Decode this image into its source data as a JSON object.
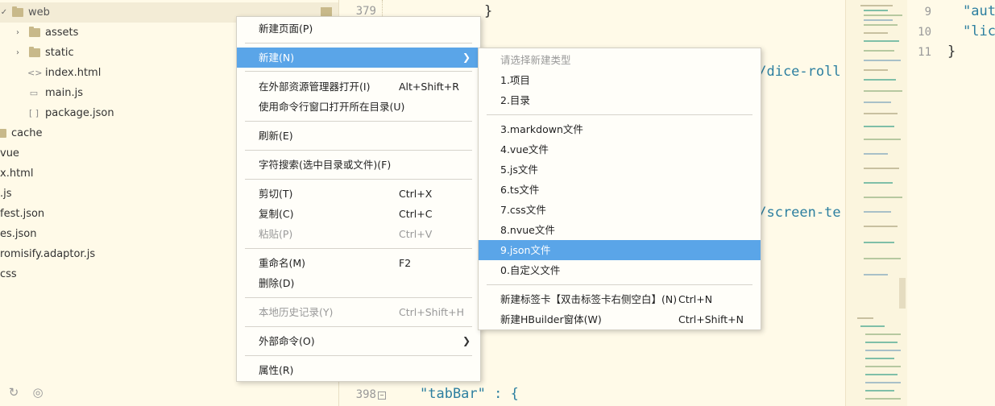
{
  "sidebar": {
    "items": [
      {
        "label": "web",
        "icon": "folder-icon"
      },
      {
        "label": "assets",
        "icon": "folder-icon"
      },
      {
        "label": "static",
        "icon": "folder-icon"
      },
      {
        "label": "index.html",
        "icon": "html-file-icon"
      },
      {
        "label": "main.js",
        "icon": "js-file-icon"
      },
      {
        "label": "package.json",
        "icon": "json-file-icon"
      },
      {
        "label": "cache",
        "icon": "folder-icon"
      },
      {
        "label": "vue",
        "icon": "file-icon"
      },
      {
        "label": "x.html",
        "icon": "file-icon"
      },
      {
        "label": ".js",
        "icon": "file-icon"
      },
      {
        "label": "fest.json",
        "icon": "file-icon"
      },
      {
        "label": "es.json",
        "icon": "file-icon"
      },
      {
        "label": "romisify.adaptor.js",
        "icon": "file-icon"
      },
      {
        "label": "css",
        "icon": "file-icon"
      }
    ],
    "footer_icons": [
      "refresh-icon",
      "globe-icon"
    ]
  },
  "editor": {
    "lines": [
      {
        "num": "379",
        "text": "}"
      },
      {
        "num": "398",
        "text": "\"tabBar\" : {"
      }
    ],
    "fragments": [
      "c/dice-roll",
      "c/screen-te"
    ]
  },
  "right_editor": {
    "lines": [
      {
        "num": "9",
        "text": "\"aut"
      },
      {
        "num": "10",
        "text": "\"lic"
      },
      {
        "num": "11",
        "text": "}"
      }
    ]
  },
  "context_menu": {
    "items": [
      {
        "label": "新建页面(P)",
        "shortcut": ""
      },
      {
        "label": "新建(N)",
        "shortcut": "",
        "submenu": true
      },
      {
        "label": "在外部资源管理器打开(I)",
        "shortcut": "Alt+Shift+R"
      },
      {
        "label": "使用命令行窗口打开所在目录(U)",
        "shortcut": ""
      },
      {
        "label": "刷新(E)",
        "shortcut": ""
      },
      {
        "label": "字符搜索(选中目录或文件)(F)",
        "shortcut": ""
      },
      {
        "label": "剪切(T)",
        "shortcut": "Ctrl+X"
      },
      {
        "label": "复制(C)",
        "shortcut": "Ctrl+C"
      },
      {
        "label": "粘贴(P)",
        "shortcut": "Ctrl+V",
        "disabled": true
      },
      {
        "label": "重命名(M)",
        "shortcut": "F2"
      },
      {
        "label": "删除(D)",
        "shortcut": ""
      },
      {
        "label": "本地历史记录(Y)",
        "shortcut": "Ctrl+Shift+H",
        "disabled": true
      },
      {
        "label": "外部命令(O)",
        "shortcut": "",
        "submenu": true
      },
      {
        "label": "属性(R)",
        "shortcut": ""
      }
    ]
  },
  "submenu": {
    "header": "请选择新建类型",
    "items": [
      {
        "label": "1.项目",
        "shortcut": ""
      },
      {
        "label": "2.目录",
        "shortcut": ""
      },
      {
        "label": "3.markdown文件",
        "shortcut": ""
      },
      {
        "label": "4.vue文件",
        "shortcut": ""
      },
      {
        "label": "5.js文件",
        "shortcut": ""
      },
      {
        "label": "6.ts文件",
        "shortcut": ""
      },
      {
        "label": "7.css文件",
        "shortcut": ""
      },
      {
        "label": "8.nvue文件",
        "shortcut": ""
      },
      {
        "label": "9.json文件",
        "shortcut": ""
      },
      {
        "label": "0.自定义文件",
        "shortcut": ""
      },
      {
        "label": "新建标签卡【双击标签卡右侧空白】(N)",
        "shortcut": "Ctrl+N"
      },
      {
        "label": "新建HBuilder窗体(W)",
        "shortcut": "Ctrl+Shift+N"
      }
    ]
  },
  "colors": {
    "highlight": "#5aa5e8",
    "background": "#fffae8",
    "string": "#2c7fa0"
  }
}
